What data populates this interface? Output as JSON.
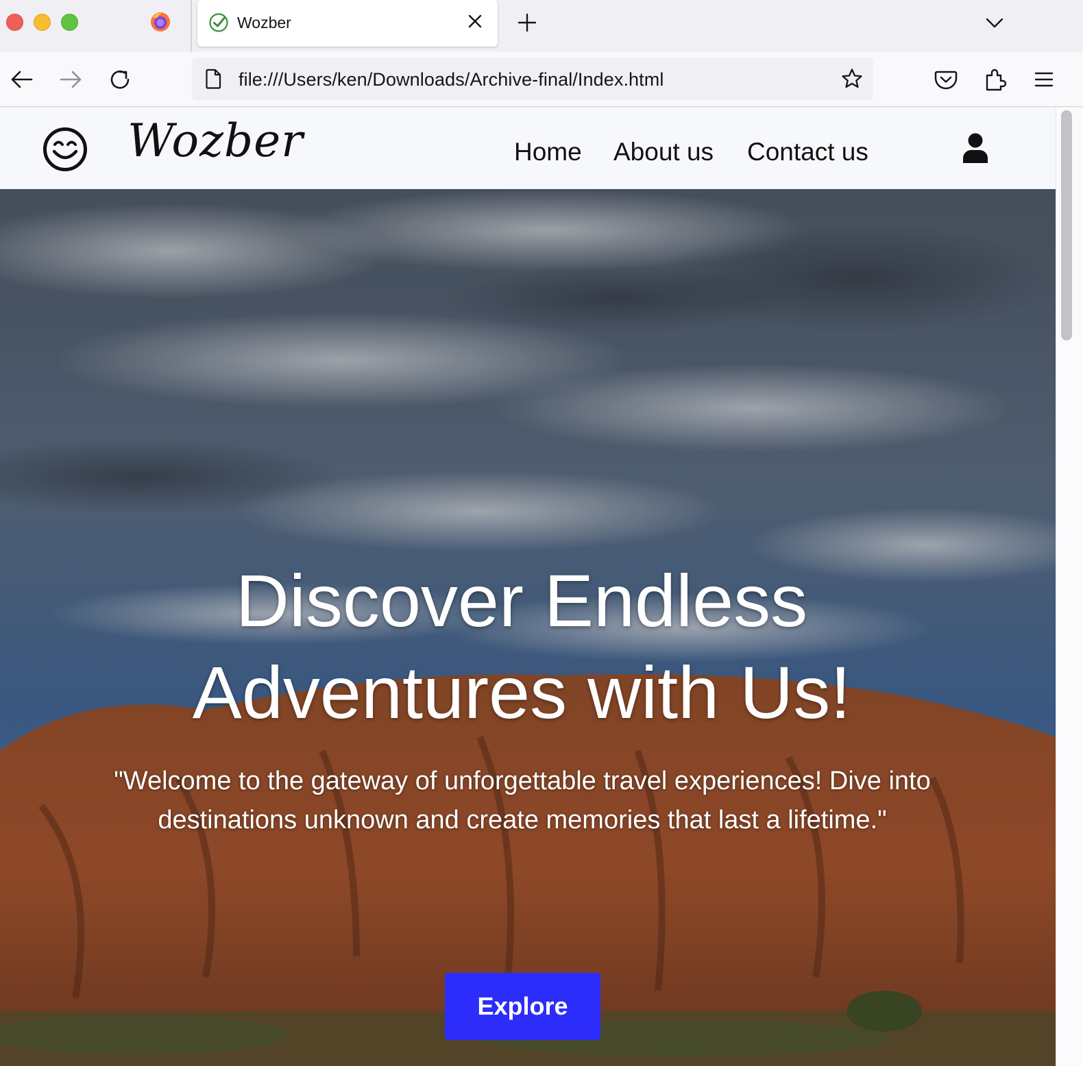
{
  "browser": {
    "tab": {
      "title": "Wozber"
    },
    "url": "file:///Users/ken/Downloads/Archive-final/Index.html"
  },
  "site": {
    "brand": "Wozber",
    "nav": [
      "Home",
      "About us",
      "Contact us"
    ],
    "hero": {
      "title_line1": "Discover Endless",
      "title_line2": "Adventures with Us!",
      "subtitle": "\"Welcome to the gateway of unforgettable travel experiences! Dive into destinations unknown and create memories that last a lifetime.\"",
      "cta": "Explore"
    }
  },
  "colors": {
    "cta_background": "#2d2dfb",
    "header_background": "#f7f8fc",
    "browser_chrome": "#f0f0f4"
  },
  "icons": [
    "firefox-icon",
    "favicon-check-icon",
    "close-icon",
    "plus-icon",
    "chevron-down-icon",
    "back-arrow-icon",
    "forward-arrow-icon",
    "reload-icon",
    "page-icon",
    "star-icon",
    "pocket-icon",
    "extensions-icon",
    "hamburger-menu-icon",
    "smiley-icon",
    "user-icon"
  ]
}
